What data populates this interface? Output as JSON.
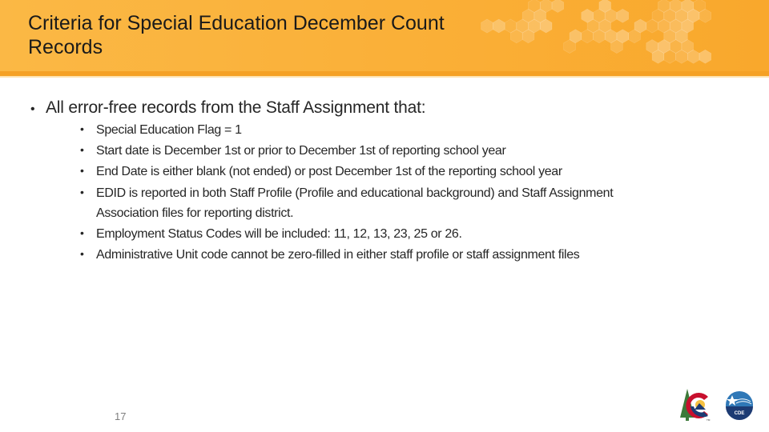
{
  "slide": {
    "title": "Criteria for Special Education December Count Records",
    "title_line1": "Criteria for Special Education December Count",
    "title_line2": "Records",
    "colors": {
      "header": "#fab13a",
      "header_stripe": "#f5a125",
      "text": "#262626",
      "page_number": "#7f7f7f"
    },
    "main_bullet": "All error-free records from the Staff Assignment that:",
    "sub_bullets": [
      "Special Education Flag = 1",
      "Start date is December 1st or prior to December 1st of reporting school year",
      "End Date is either blank (not ended) or post December 1st of the reporting school year",
      "EDID is reported in both Staff Profile (Profile and educational background) and Staff Assignment Association files for reporting district.",
      "Employment Status Codes will be included: 11, 12, 13, 23, 25 or 26.",
      "Administrative Unit code cannot be zero-filled in either staff profile or staff assignment files"
    ],
    "page_number": "17",
    "logos": {
      "colorado_logo": "colorado-c-logo",
      "cde_logo": "cde-seal-logo",
      "cde_label": "CDE"
    }
  }
}
